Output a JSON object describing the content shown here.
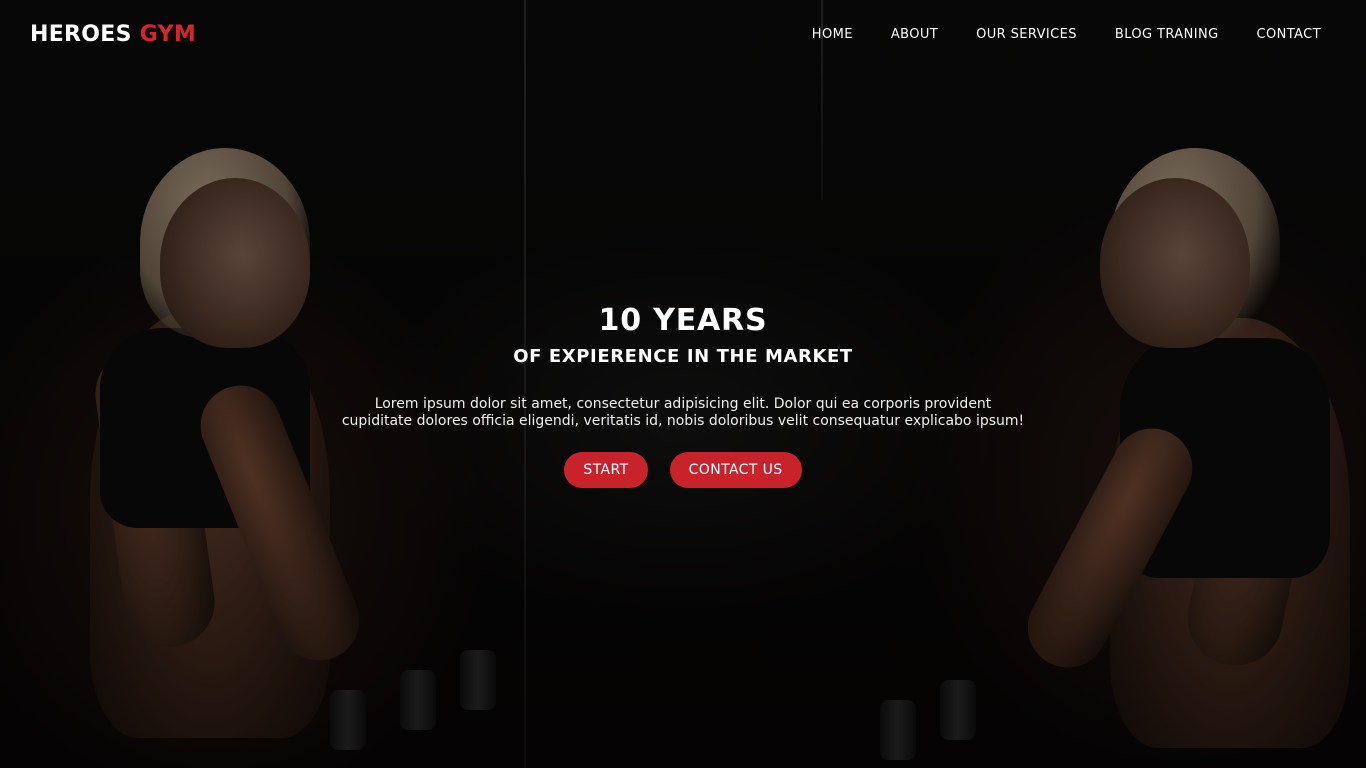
{
  "brand": {
    "name_main": "HEROES",
    "name_accent": "GYM",
    "accent_color": "#d5262c"
  },
  "nav": {
    "items": [
      {
        "label": "HOME"
      },
      {
        "label": "ABOUT"
      },
      {
        "label": "OUR SERVICES"
      },
      {
        "label": "BLOG TRANING"
      },
      {
        "label": "CONTACT"
      }
    ]
  },
  "hero": {
    "headline": "10 YEARS",
    "subheadline": "OF EXPIERENCE IN THE MARKET",
    "description_line1": "Lorem ipsum dolor sit amet, consectetur adipisicing elit. Dolor qui ea corporis provident",
    "description_line2": "cupiditate dolores officia eligendi, veritatis id, nobis doloribus velit consequatur explicabo ipsum!",
    "buttons": {
      "start_label": "START",
      "contact_label": "CONTACT US",
      "color": "#c8232a"
    },
    "background_image": "woman-lifting-dumbbells-mirror-photo"
  }
}
